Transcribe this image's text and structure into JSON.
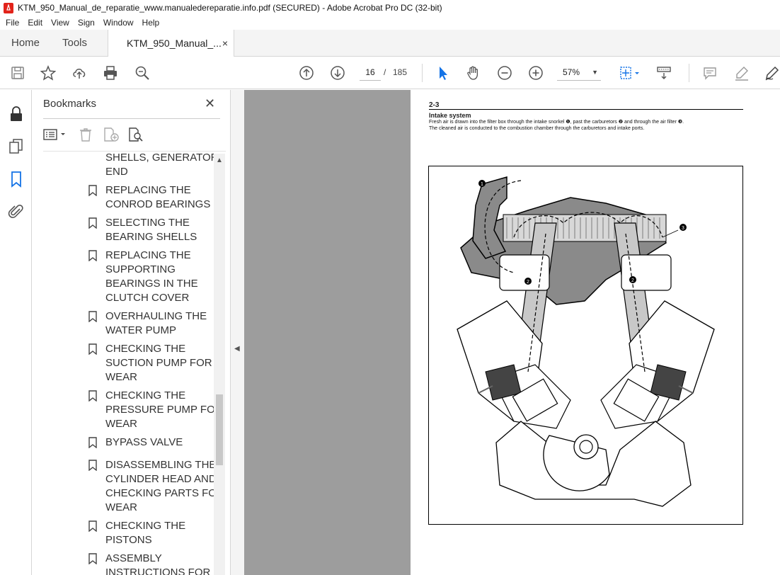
{
  "window": {
    "title": "KTM_950_Manual_de_reparatie_www.manualedereparatie.info.pdf (SECURED) - Adobe Acrobat Pro DC (32-bit)"
  },
  "menu": [
    "File",
    "Edit",
    "View",
    "Sign",
    "Window",
    "Help"
  ],
  "tabs": {
    "home": "Home",
    "tools": "Tools",
    "document": "KTM_950_Manual_...",
    "close": "×"
  },
  "toolbar": {
    "current_page": "16",
    "separator": "/",
    "total_pages": "185",
    "zoom": "57%",
    "icons": [
      "save-icon",
      "star-icon",
      "upload-icon",
      "print-icon",
      "search-zoom-icon",
      "page-up-icon",
      "page-down-icon",
      "cursor-icon",
      "hand-icon",
      "zoom-out-icon",
      "zoom-in-icon",
      "fit-page-icon",
      "scroll-mode-icon",
      "comment-icon",
      "highlight-icon",
      "sign-icon"
    ]
  },
  "bookmarks": {
    "title": "Bookmarks",
    "close": "✕",
    "items": [
      "SHELLS, GENERATOR END",
      "REPLACING THE CONROD BEARINGS",
      "SELECTING THE BEARING SHELLS",
      "REPLACING THE SUPPORTING BEARINGS IN THE CLUTCH COVER",
      "OVERHAULING THE WATER PUMP",
      "CHECKING THE SUCTION PUMP FOR WEAR",
      "CHECKING THE PRESSURE PUMP FOR WEAR",
      "BYPASS VALVE",
      "DISASSEMBLING THE CYLINDER HEAD AND CHECKING PARTS FOR WEAR",
      "CHECKING THE PISTONS",
      "ASSEMBLY INSTRUCTIONS FOR"
    ]
  },
  "page": {
    "number": "2-3",
    "heading": "Intake system",
    "line1": "Fresh air is drawn into the filter box through the intake snorkel ❶, past the carburetors ❷ and through the air filter ❸.",
    "line2": "The cleaned air is conducted to the combustion chamber through the carburetors and intake ports.",
    "callouts": [
      "1",
      "2",
      "2",
      "3"
    ]
  },
  "colors": {
    "accent": "#1473e6",
    "viewer_bg": "#9d9d9d",
    "app_red": "#e2231a"
  }
}
